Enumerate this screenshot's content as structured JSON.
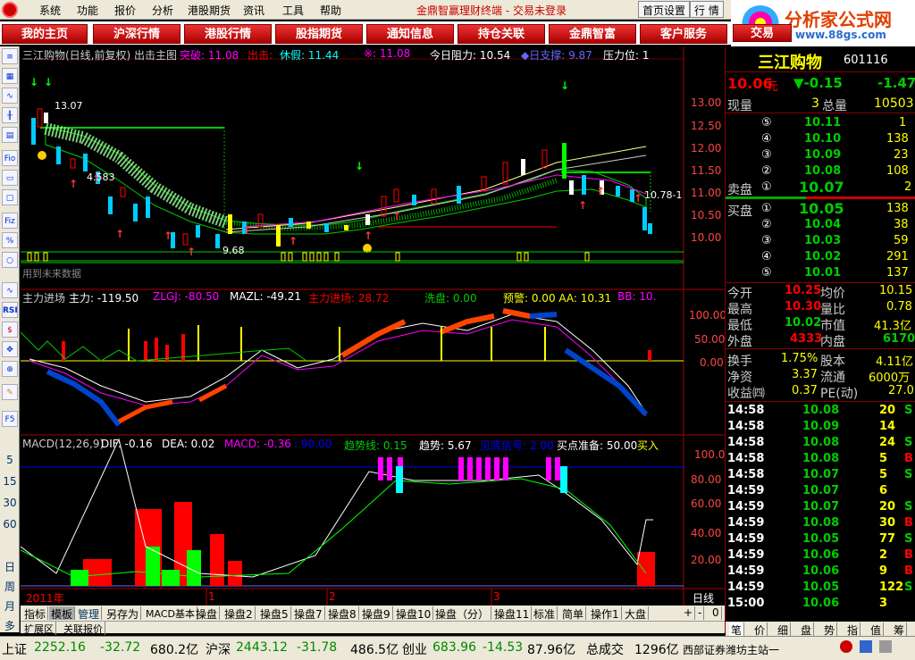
{
  "menu": {
    "items": [
      "系统",
      "功能",
      "报价",
      "分析",
      "港股期货",
      "资讯",
      "工具",
      "帮助"
    ],
    "center": "金鼎智赢理财终端  -  交易未登录",
    "home_btn": "首页设置",
    "quote_btn": "行 情"
  },
  "brand": {
    "name": "分析家公式网",
    "url": "www.88gs.com"
  },
  "nav": [
    "我的主页",
    "沪深行情",
    "港股行情",
    "股指期货",
    "通知信息",
    "持仓关联",
    "金鼎智富",
    "客户服务",
    "交易"
  ],
  "left_tools": [
    "5",
    "15",
    "30",
    "60",
    "日",
    "周",
    "月",
    "多"
  ],
  "main_chart": {
    "title": "三江购物(日线,前复权) 出击主图",
    "tupo": "突破: 11.08",
    "chuji": "出击: ",
    "xiujia": "休假: 11.44",
    "x": "※: 11.08",
    "zuli": "今日阻力: 10.54",
    "rizhi": "◆日支撑: 9.87",
    "yali": "压力位: 1",
    "labels": {
      "hi": "13.07",
      "lo": "9.68",
      "mid": "4.583",
      "right": "10.78-1",
      "future": "用到未来数据"
    },
    "yaxis": [
      "13.00",
      "12.50",
      "12.00",
      "11.50",
      "11.00",
      "10.50",
      "10.00"
    ]
  },
  "ind1": {
    "title": "主力进场",
    "zl": "主力: -119.50",
    "zlgj": "ZLGJ: -80.50",
    "mazl": "MAZL: -49.21",
    "zljc": "主力进场: 28.72",
    "xp": "洗盘: 0.00",
    "yj": "预警: 0.00 AA: 10.31",
    "bb": "BB: 10.",
    "yaxis": [
      "100.00",
      "50.00",
      "0.00"
    ]
  },
  "ind2": {
    "macd": "MACD(12,26,9)",
    "dif": "DIF: -0.16",
    "dea": "DEA: 0.02",
    "m": "MACD: -0.36",
    "v90": ": 90.00",
    "qsx": "趋势线: 0.15",
    "qs": "趋势: 5.67",
    "jc": "见底信号: 2.00",
    "md": "买点准备: 50.00",
    "mr": "买入",
    "yaxis": [
      "100.0",
      "80.00",
      "60.00",
      "40.00",
      "20.00"
    ]
  },
  "x_axis": {
    "year": "2011年",
    "m1": "1",
    "m2": "2",
    "m3": "3",
    "period": "日线"
  },
  "stock": {
    "name": "三江购物",
    "code": "601116",
    "price": "10.06",
    "unit": "元",
    "change": "▼-0.15",
    "pct": "-1.47",
    "xianpan": "现量",
    "xp_val": "3",
    "zongliang": "总量",
    "zl_val": "10503"
  },
  "asks": [
    {
      "n": "⑤",
      "p": "10.11",
      "v": "1"
    },
    {
      "n": "④",
      "p": "10.10",
      "v": "138"
    },
    {
      "n": "③",
      "p": "10.09",
      "v": "23"
    },
    {
      "n": "②",
      "p": "10.08",
      "v": "108"
    },
    {
      "n": "①",
      "p": "10.07",
      "v": "2"
    }
  ],
  "bids": [
    {
      "n": "①",
      "p": "10.05",
      "v": "138"
    },
    {
      "n": "②",
      "p": "10.04",
      "v": "38"
    },
    {
      "n": "③",
      "p": "10.03",
      "v": "59"
    },
    {
      "n": "④",
      "p": "10.02",
      "v": "291"
    },
    {
      "n": "⑤",
      "p": "10.01",
      "v": "137"
    }
  ],
  "sell_label": "卖盘",
  "buy_label": "买盘",
  "stats": [
    {
      "l1": "今开",
      "v1": "10.25",
      "l2": "均价",
      "v2": "10.15"
    },
    {
      "l1": "最高",
      "v1": "10.30",
      "l2": "量比",
      "v2": "0.78"
    },
    {
      "l1": "最低",
      "v1": "10.02",
      "l2": "市值",
      "v2": "41.3亿"
    },
    {
      "l1": "外盘",
      "v1": "4333",
      "l2": "内盘",
      "v2": "6170"
    },
    {
      "l1": "换手",
      "v1": "1.75%",
      "l2": "股本",
      "v2": "4.11亿"
    },
    {
      "l1": "净资",
      "v1": "3.37",
      "l2": "流通",
      "v2": "6000万"
    },
    {
      "l1": "收益㈣",
      "v1": "0.37",
      "l2": "PE(动)",
      "v2": "27.0"
    }
  ],
  "ticks": [
    {
      "t": "14:58",
      "p": "10.08",
      "v": "20",
      "s": "S"
    },
    {
      "t": "14:58",
      "p": "10.09",
      "v": "14",
      "s": ""
    },
    {
      "t": "14:58",
      "p": "10.08",
      "v": "24",
      "s": "S"
    },
    {
      "t": "14:58",
      "p": "10.08",
      "v": "5",
      "s": "B"
    },
    {
      "t": "14:58",
      "p": "10.07",
      "v": "5",
      "s": "S"
    },
    {
      "t": "14:59",
      "p": "10.07",
      "v": "6",
      "s": ""
    },
    {
      "t": "14:59",
      "p": "10.07",
      "v": "20",
      "s": "S"
    },
    {
      "t": "14:59",
      "p": "10.08",
      "v": "30",
      "s": "B"
    },
    {
      "t": "14:59",
      "p": "10.05",
      "v": "77",
      "s": "S"
    },
    {
      "t": "14:59",
      "p": "10.06",
      "v": "2",
      "s": "B"
    },
    {
      "t": "14:59",
      "p": "10.06",
      "v": "9",
      "s": "B"
    },
    {
      "t": "14:59",
      "p": "10.05",
      "v": "122",
      "s": "S"
    },
    {
      "t": "15:00",
      "p": "10.06",
      "v": "3",
      "s": ""
    }
  ],
  "bottom_tabs": [
    "指标",
    "模板",
    "管理",
    "另存为",
    "MACD基本",
    "操盘",
    "操盘2",
    "操盘5",
    "操盘7",
    "操盘8",
    "操盘9",
    "操盘10",
    "操盘（分）",
    "操盘11",
    "标准",
    "简单",
    "操作1",
    "大盘"
  ],
  "bottom_right": [
    "+",
    "-",
    "0"
  ],
  "extra_tabs": [
    "扩展区",
    "关联报价"
  ],
  "info_tabs": [
    "笔",
    "价",
    "细",
    "盘",
    "势",
    "指",
    "值",
    "筹"
  ],
  "status": {
    "sh": "上证",
    "sh_v": "2252.16",
    "sh_c": "-32.72",
    "sh_a": "680.2亿",
    "hs": "沪深",
    "hs_v": "2443.12",
    "hs_c": "-31.78",
    "hs_a": "486.5亿",
    "cy": "创业",
    "cy_v": "683.96",
    "cy_c": "-14.53",
    "cy_a": "87.96亿",
    "zcj": "总成交",
    "zcj_v": "1296亿",
    "site": "西部证券潍坊主站一"
  }
}
